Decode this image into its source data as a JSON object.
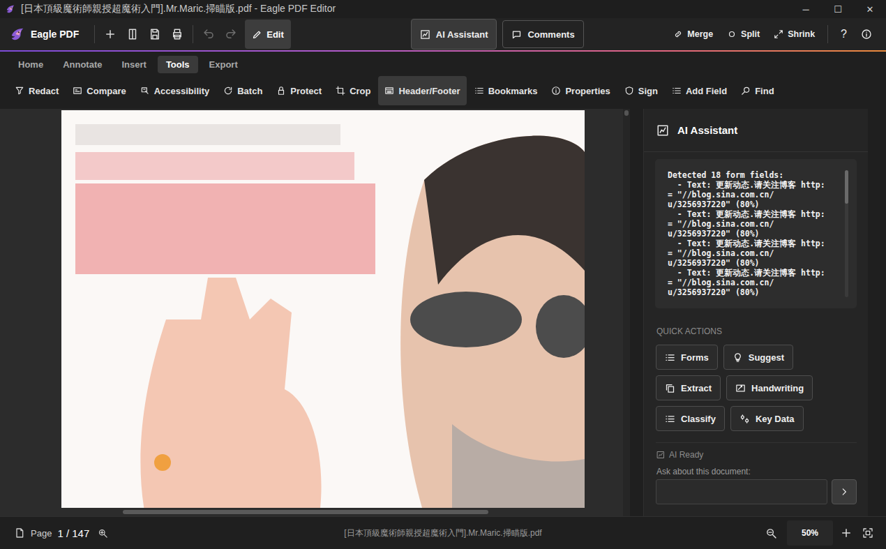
{
  "window": {
    "title": "[日本頂級魔術師親授超魔術入門].Mr.Maric.掃瞄版.pdf - Eagle PDF Editor",
    "controls": [
      "─",
      "☐",
      "✕"
    ]
  },
  "toolbar": {
    "app_name": "Eagle PDF",
    "undo": {
      "disabled": true
    },
    "redo": {
      "disabled": true
    },
    "edit": {
      "label": "Edit",
      "selected": true
    },
    "panels": [
      {
        "label": "AI Assistant",
        "selected": true
      },
      {
        "label": "Comments",
        "selected": false
      }
    ],
    "actions": [
      "Merge",
      "Split",
      "Shrink"
    ],
    "help": "?"
  },
  "tabs": [
    {
      "label": "Home",
      "selected": false
    },
    {
      "label": "Annotate",
      "selected": false
    },
    {
      "label": "Insert",
      "selected": false
    },
    {
      "label": "Tools",
      "selected": true
    },
    {
      "label": "Export",
      "selected": false
    }
  ],
  "tools": [
    {
      "label": "Redact",
      "selected": false
    },
    {
      "label": "Compare",
      "selected": false
    },
    {
      "label": "Accessibility",
      "selected": false
    },
    {
      "label": "Batch",
      "selected": false
    },
    {
      "label": "Protect",
      "selected": false
    },
    {
      "label": "Crop",
      "selected": false
    },
    {
      "label": "Header/Footer",
      "selected": true
    },
    {
      "label": "Bookmarks",
      "selected": false
    },
    {
      "label": "Properties",
      "selected": false
    },
    {
      "label": "Sign",
      "selected": false
    },
    {
      "label": "Add Field",
      "selected": false
    },
    {
      "label": "Find",
      "selected": false
    }
  ],
  "ai_panel": {
    "title": "AI Assistant",
    "output": {
      "heading": "Detected 18 form fields:",
      "entries": [
        {
          "lines": [
            "  - Text: 更新动态.请关注博客 http:",
            "= \"//blog.sina.com.cn/",
            "u/3256937220\" (80%)"
          ]
        },
        {
          "lines": [
            "  - Text: 更新动态.请关注博客 http:",
            "= \"//blog.sina.com.cn/",
            "u/3256937220\" (80%)"
          ]
        },
        {
          "lines": [
            "  - Text: 更新动态.请关注博客 http:",
            "= \"//blog.sina.com.cn/",
            "u/3256937220\" (80%)"
          ]
        },
        {
          "lines": [
            "  - Text: 更新动态.请关注博客 http:",
            "= \"//blog.sina.com.cn/",
            "u/3256937220\" (80%)"
          ]
        }
      ]
    },
    "quick_actions_label": "QUICK ACTIONS",
    "quick_actions": [
      "Forms",
      "Suggest",
      "Extract",
      "Handwriting",
      "Classify",
      "Key Data"
    ],
    "status": "AI Ready",
    "prompt_label": "Ask about this document:"
  },
  "status_bar": {
    "page_label": "Page",
    "page": "1 / 147",
    "filename": "[日本頂級魔術師親授超魔術入門].Mr.Maric.掃瞄版.pdf",
    "zoom": "50%"
  }
}
